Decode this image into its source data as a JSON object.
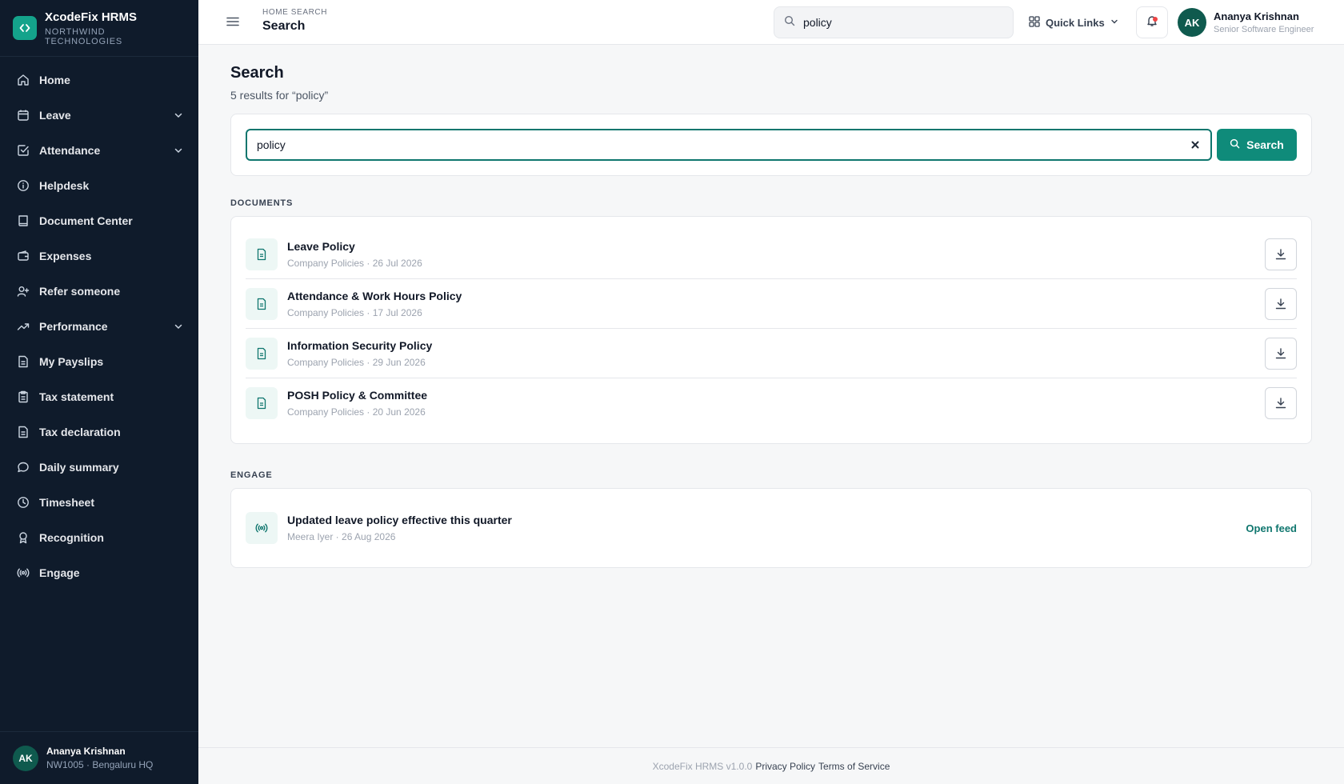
{
  "brand": {
    "name": "XcodeFix HRMS",
    "org": "NORTHWIND TECHNOLOGIES",
    "logo_glyph": "‹›",
    "accent": "#14a38b"
  },
  "sidebar": {
    "items": [
      {
        "label": "Home",
        "icon": "home-icon"
      },
      {
        "label": "Leave",
        "icon": "calendar-icon",
        "expandable": true
      },
      {
        "label": "Attendance",
        "icon": "check-square-icon",
        "expandable": true
      },
      {
        "label": "Helpdesk",
        "icon": "info-icon"
      },
      {
        "label": "Document Center",
        "icon": "book-icon"
      },
      {
        "label": "Expenses",
        "icon": "wallet-icon"
      },
      {
        "label": "Refer someone",
        "icon": "user-plus-icon"
      },
      {
        "label": "Performance",
        "icon": "trend-icon",
        "expandable": true
      },
      {
        "label": "My Payslips",
        "icon": "file-icon"
      },
      {
        "label": "Tax statement",
        "icon": "clipboard-icon"
      },
      {
        "label": "Tax declaration",
        "icon": "file-icon"
      },
      {
        "label": "Daily summary",
        "icon": "chat-icon"
      },
      {
        "label": "Timesheet",
        "icon": "clock-icon"
      },
      {
        "label": "Recognition",
        "icon": "award-icon"
      },
      {
        "label": "Engage",
        "icon": "broadcast-icon"
      }
    ],
    "user": {
      "initials": "AK",
      "name": "Ananya Krishnan",
      "sub": "NW1005 · Bengaluru HQ"
    }
  },
  "topbar": {
    "breadcrumb": "HOME SEARCH",
    "title": "Search",
    "search_value": "policy",
    "quick_links": "Quick Links",
    "user": {
      "initials": "AK",
      "name": "Ananya Krishnan",
      "role": "Senior Software Engineer"
    }
  },
  "main": {
    "title": "Search",
    "result_summary": "5 results for “policy”",
    "search_value": "policy",
    "search_button": "Search",
    "documents_label": "DOCUMENTS",
    "documents": [
      {
        "title": "Leave Policy",
        "meta": "Company Policies · 26 Jul 2026"
      },
      {
        "title": "Attendance & Work Hours Policy",
        "meta": "Company Policies · 17 Jul 2026"
      },
      {
        "title": "Information Security Policy",
        "meta": "Company Policies · 29 Jun 2026"
      },
      {
        "title": "POSH Policy & Committee",
        "meta": "Company Policies · 20 Jun 2026"
      }
    ],
    "engage_label": "ENGAGE",
    "engage": {
      "title": "Updated leave policy effective this quarter",
      "meta": "Meera Iyer · 26 Aug 2026",
      "action": "Open feed"
    }
  },
  "footer": {
    "version": "XcodeFix HRMS v1.0.0",
    "privacy": "Privacy Policy",
    "terms": "Terms of Service"
  }
}
